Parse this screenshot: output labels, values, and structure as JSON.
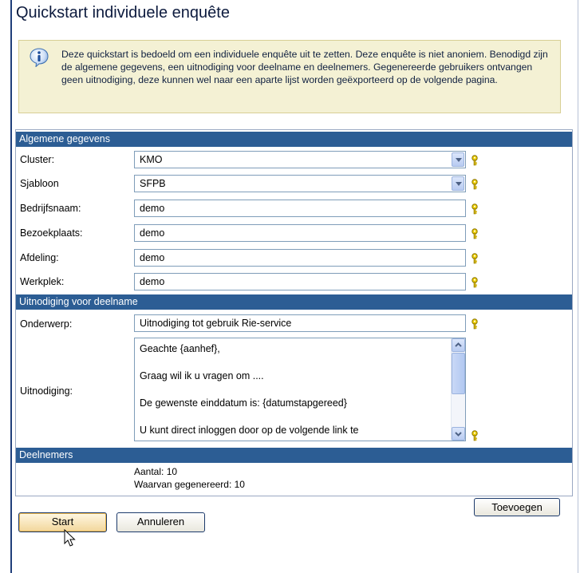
{
  "page": {
    "title": "Quickstart individuele enquête",
    "info_text": "Deze quickstart is bedoeld om een individuele enquête uit te zetten. Deze enquête is niet anoniem. Benodigd zijn de algemene gegevens, een uitnodiging voor deelname en deelnemers. Gegenereerde gebruikers ontvangen geen uitnodiging, deze kunnen wel naar een aparte lijst worden geëxporteerd op de volgende pagina.",
    "info_icon": "info-icon"
  },
  "sections": {
    "general": "Algemene gegevens",
    "invitation": "Uitnodiging voor deelname",
    "participants": "Deelnemers"
  },
  "fields": {
    "cluster": {
      "label": "Cluster:",
      "value": "KMO"
    },
    "sjabloon": {
      "label": "Sjabloon",
      "value": "SFPB"
    },
    "bedrijfsnaam": {
      "label": "Bedrijfsnaam:",
      "value": "demo"
    },
    "bezoekplaats": {
      "label": "Bezoekplaats:",
      "value": "demo"
    },
    "afdeling": {
      "label": "Afdeling:",
      "value": "demo"
    },
    "werkplek": {
      "label": "Werkplek:",
      "value": "demo"
    },
    "onderwerp": {
      "label": "Onderwerp:",
      "value": "Uitnodiging tot gebruik Rie-service"
    },
    "uitnodiging": {
      "label": "Uitnodiging:",
      "lines": [
        "Geachte {aanhef},",
        "Graag wil ik u vragen om ....",
        "De gewenste einddatum is: {datumstapgereed}",
        "U kunt direct inloggen door op de volgende link te"
      ]
    }
  },
  "participants": {
    "count": "Aantal: 10",
    "generated": "Waarvan gegenereerd: 10",
    "add_button": "Toevoegen"
  },
  "buttons": {
    "start": "Start",
    "cancel": "Annuleren"
  },
  "colors": {
    "section_header": "#2c5d94",
    "info_background": "#f4f1d4",
    "key_icon": "#e8c400"
  }
}
